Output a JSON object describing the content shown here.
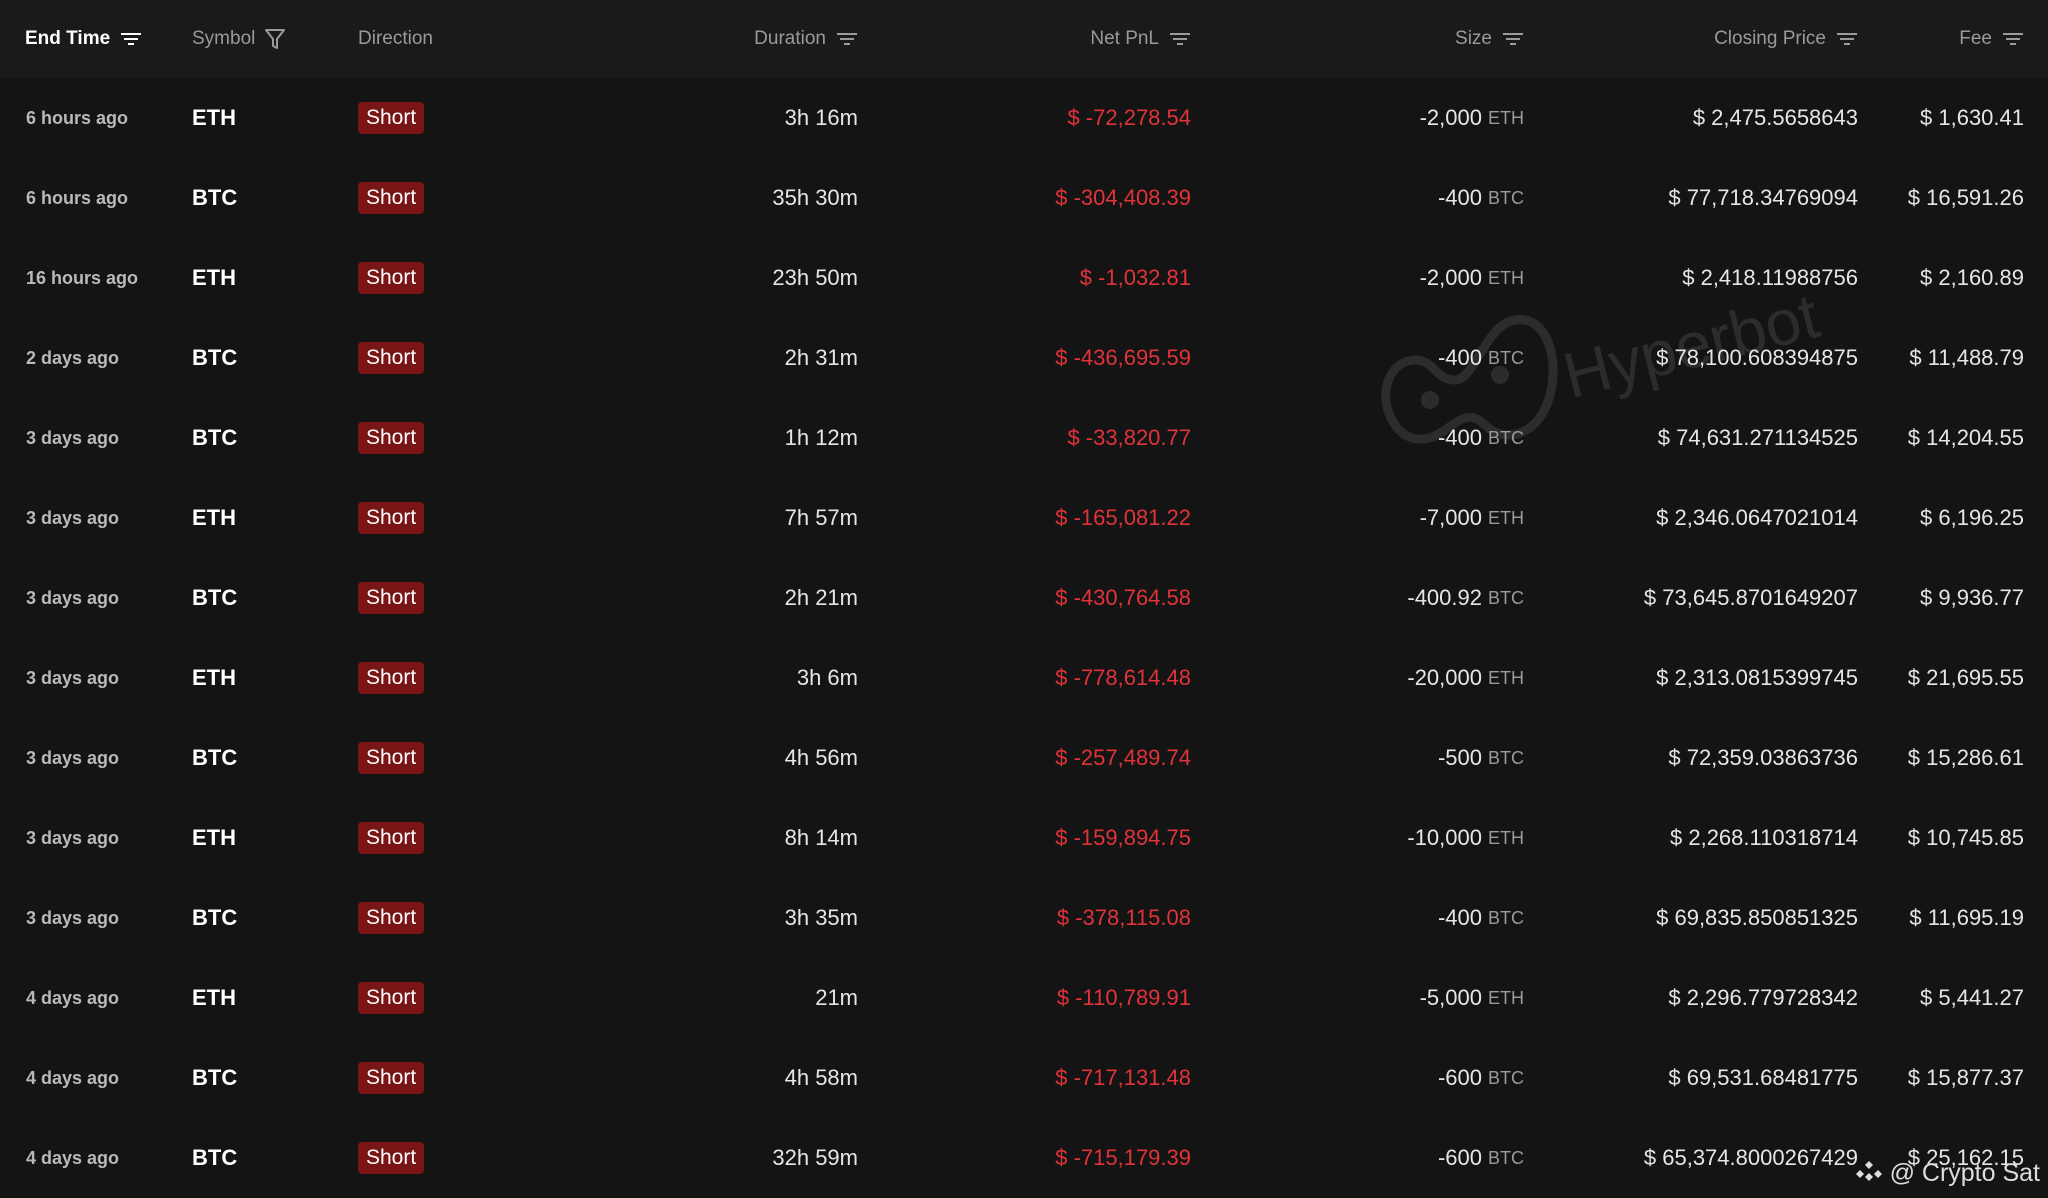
{
  "header": {
    "columns": [
      {
        "label": "End Time",
        "icon": "sort-icon"
      },
      {
        "label": "Symbol",
        "icon": "filter-icon"
      },
      {
        "label": "Direction",
        "icon": ""
      },
      {
        "label": "Duration",
        "icon": "sort-icon"
      },
      {
        "label": "Net PnL",
        "icon": "sort-icon"
      },
      {
        "label": "Size",
        "icon": "sort-icon"
      },
      {
        "label": "Closing Price",
        "icon": "sort-icon"
      },
      {
        "label": "Fee",
        "icon": "sort-icon"
      }
    ]
  },
  "rows": [
    {
      "end_time": "6 hours ago",
      "symbol": "ETH",
      "direction": "Short",
      "duration": "3h 16m",
      "net_pnl": "$ -72,278.54",
      "size": "-2,000",
      "size_unit": "ETH",
      "closing_price": "$ 2,475.5658643",
      "fee": "$ 1,630.41"
    },
    {
      "end_time": "6 hours ago",
      "symbol": "BTC",
      "direction": "Short",
      "duration": "35h 30m",
      "net_pnl": "$ -304,408.39",
      "size": "-400",
      "size_unit": "BTC",
      "closing_price": "$ 77,718.34769094",
      "fee": "$ 16,591.26"
    },
    {
      "end_time": "16 hours ago",
      "symbol": "ETH",
      "direction": "Short",
      "duration": "23h 50m",
      "net_pnl": "$ -1,032.81",
      "size": "-2,000",
      "size_unit": "ETH",
      "closing_price": "$ 2,418.11988756",
      "fee": "$ 2,160.89"
    },
    {
      "end_time": "2 days ago",
      "symbol": "BTC",
      "direction": "Short",
      "duration": "2h 31m",
      "net_pnl": "$ -436,695.59",
      "size": "-400",
      "size_unit": "BTC",
      "closing_price": "$ 78,100.608394875",
      "fee": "$ 11,488.79"
    },
    {
      "end_time": "3 days ago",
      "symbol": "BTC",
      "direction": "Short",
      "duration": "1h 12m",
      "net_pnl": "$ -33,820.77",
      "size": "-400",
      "size_unit": "BTC",
      "closing_price": "$ 74,631.271134525",
      "fee": "$ 14,204.55"
    },
    {
      "end_time": "3 days ago",
      "symbol": "ETH",
      "direction": "Short",
      "duration": "7h 57m",
      "net_pnl": "$ -165,081.22",
      "size": "-7,000",
      "size_unit": "ETH",
      "closing_price": "$ 2,346.0647021014",
      "fee": "$ 6,196.25"
    },
    {
      "end_time": "3 days ago",
      "symbol": "BTC",
      "direction": "Short",
      "duration": "2h 21m",
      "net_pnl": "$ -430,764.58",
      "size": "-400.92",
      "size_unit": "BTC",
      "closing_price": "$ 73,645.8701649207",
      "fee": "$ 9,936.77"
    },
    {
      "end_time": "3 days ago",
      "symbol": "ETH",
      "direction": "Short",
      "duration": "3h 6m",
      "net_pnl": "$ -778,614.48",
      "size": "-20,000",
      "size_unit": "ETH",
      "closing_price": "$ 2,313.0815399745",
      "fee": "$ 21,695.55"
    },
    {
      "end_time": "3 days ago",
      "symbol": "BTC",
      "direction": "Short",
      "duration": "4h 56m",
      "net_pnl": "$ -257,489.74",
      "size": "-500",
      "size_unit": "BTC",
      "closing_price": "$ 72,359.03863736",
      "fee": "$ 15,286.61"
    },
    {
      "end_time": "3 days ago",
      "symbol": "ETH",
      "direction": "Short",
      "duration": "8h 14m",
      "net_pnl": "$ -159,894.75",
      "size": "-10,000",
      "size_unit": "ETH",
      "closing_price": "$ 2,268.110318714",
      "fee": "$ 10,745.85"
    },
    {
      "end_time": "3 days ago",
      "symbol": "BTC",
      "direction": "Short",
      "duration": "3h 35m",
      "net_pnl": "$ -378,115.08",
      "size": "-400",
      "size_unit": "BTC",
      "closing_price": "$ 69,835.850851325",
      "fee": "$ 11,695.19"
    },
    {
      "end_time": "4 days ago",
      "symbol": "ETH",
      "direction": "Short",
      "duration": "21m",
      "net_pnl": "$ -110,789.91",
      "size": "-5,000",
      "size_unit": "ETH",
      "closing_price": "$ 2,296.779728342",
      "fee": "$ 5,441.27"
    },
    {
      "end_time": "4 days ago",
      "symbol": "BTC",
      "direction": "Short",
      "duration": "4h 58m",
      "net_pnl": "$ -717,131.48",
      "size": "-600",
      "size_unit": "BTC",
      "closing_price": "$ 69,531.68481775",
      "fee": "$ 15,877.37"
    },
    {
      "end_time": "4 days ago",
      "symbol": "BTC",
      "direction": "Short",
      "duration": "32h 59m",
      "net_pnl": "$ -715,179.39",
      "size": "-600",
      "size_unit": "BTC",
      "closing_price": "$ 65,374.8000267429",
      "fee": "$ 25,162.15"
    }
  ],
  "watermark": {
    "text": "Hyperbot",
    "icon": "hyperbot-logo-icon"
  },
  "credit": {
    "text": "@ Crypto Sat",
    "icon": "binance-logo-icon"
  },
  "colors": {
    "background": "#141414",
    "header_background": "#1a1a1a",
    "negative": "#e0333a",
    "short_badge": "#7a1515"
  }
}
